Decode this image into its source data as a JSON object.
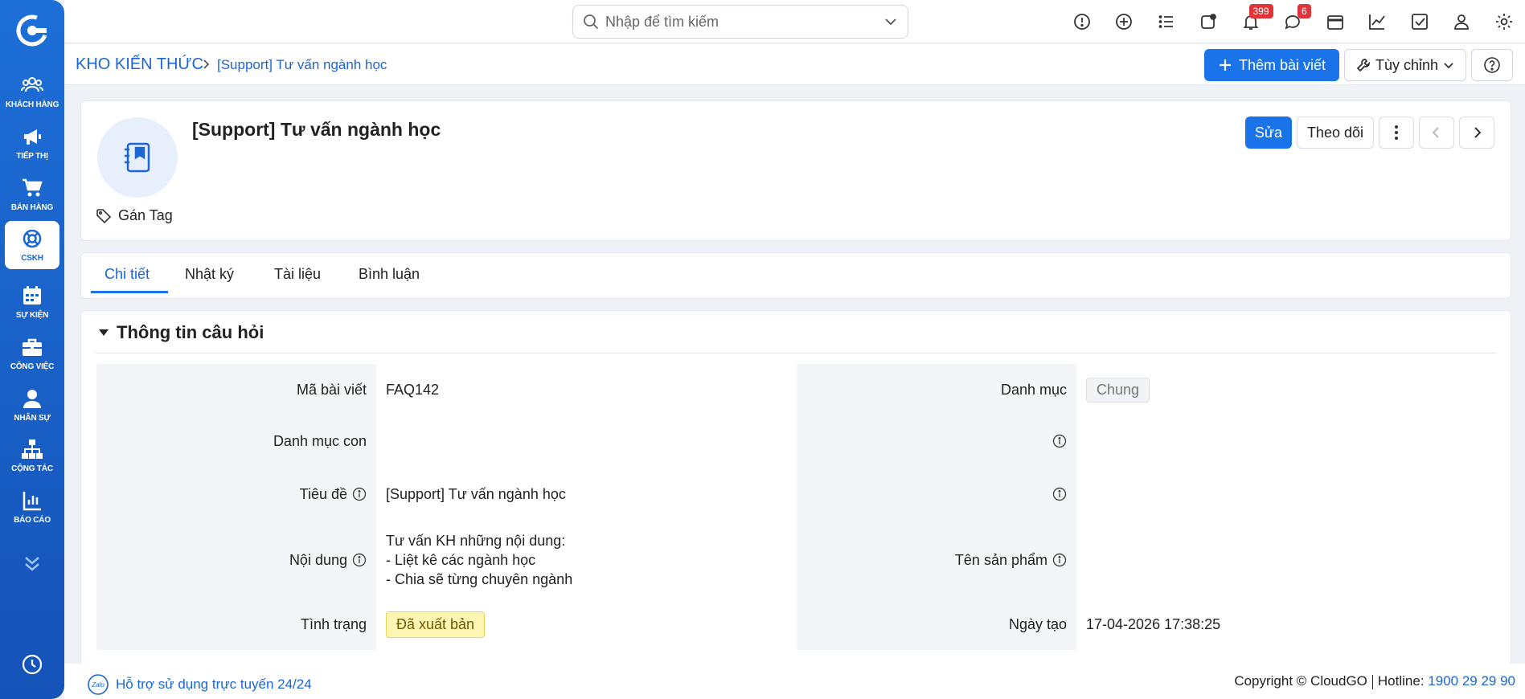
{
  "sidebar": {
    "items": [
      {
        "label": "KHÁCH HÀNG",
        "icon": "users-icon"
      },
      {
        "label": "TIẾP THỊ",
        "icon": "megaphone-icon"
      },
      {
        "label": "BÁN HÀNG",
        "icon": "cart-icon"
      },
      {
        "label": "CSKH",
        "icon": "lifebuoy-icon",
        "active": true
      },
      {
        "label": "SỰ KIỆN",
        "icon": "calendar-icon"
      },
      {
        "label": "CÔNG VIỆC",
        "icon": "briefcase-icon"
      },
      {
        "label": "NHÂN SỰ",
        "icon": "person-icon"
      },
      {
        "label": "CỘNG TÁC",
        "icon": "org-chart-icon"
      },
      {
        "label": "BÁO CÁO",
        "icon": "report-icon"
      }
    ]
  },
  "topbar": {
    "search_placeholder": "Nhập để tìm kiếm",
    "notification_count": "399",
    "message_count": "6"
  },
  "breadcrumb": {
    "root": "KHO KIẾN THỨC",
    "current": "[Support] Tư vấn ngành học"
  },
  "toolbar": {
    "add_label": "Thêm bài viết",
    "custom_label": "Tùy chỉnh"
  },
  "record": {
    "title": "[Support] Tư vấn ngành học",
    "tag_label": "Gán Tag",
    "edit_label": "Sửa",
    "follow_label": "Theo dõi"
  },
  "tabs": [
    {
      "label": "Chi tiết",
      "active": true
    },
    {
      "label": "Nhật ký"
    },
    {
      "label": "Tài liệu"
    },
    {
      "label": "Bình luận"
    }
  ],
  "section": {
    "title": "Thông tin câu hỏi",
    "fields_left": [
      {
        "label": "Mã bài viết",
        "value": "FAQ142"
      },
      {
        "label": "Danh mục con",
        "value": ""
      },
      {
        "label": "Tiêu đề",
        "value": "[Support] Tư vấn ngành học"
      },
      {
        "label": "Nội dung",
        "value_lines": [
          "Tư vấn KH những nội dung:",
          "- Liệt kê các ngành học",
          "- Chia sẽ từng chuyên ngành"
        ]
      },
      {
        "label": "Tình trạng",
        "value": "Đã xuất bản"
      }
    ],
    "fields_right": [
      {
        "label": "Danh mục",
        "value": "Chung"
      },
      {
        "label": "",
        "value": ""
      },
      {
        "label": "",
        "value": ""
      },
      {
        "label": "Tên sản phẩm",
        "value": ""
      },
      {
        "label": "Ngày tạo",
        "value": "17-04-2026 17:38:25"
      }
    ]
  },
  "footer": {
    "zalo_label": "Zalo",
    "support_text": "Hỗ trợ sử dụng trực tuyến 24/24",
    "copyright": "Copyright © CloudGO",
    "hotline_label": "Hotline:",
    "hotline_number": "1900 29 29 90"
  },
  "colors": {
    "accent": "#1a73e8",
    "sidebar": "#1a5fc8",
    "badge": "#e0343b",
    "status_published_bg": "#fff6b3"
  }
}
